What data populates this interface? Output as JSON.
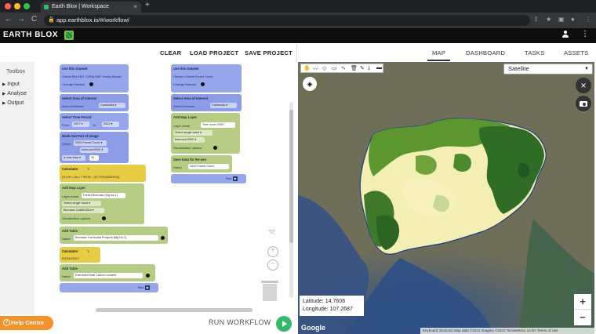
{
  "browser": {
    "tab_title": "Earth Blox | Workspace",
    "url": "app.earthblox.io/#/workflow/",
    "tab_close": "×",
    "new_tab": "+",
    "nav_back": "←",
    "nav_forward": "→",
    "nav_reload": "C",
    "lock": "🔒"
  },
  "app": {
    "logo": "EARTH BLOX",
    "more": "⋮"
  },
  "toolbar": {
    "clear": "CLEAR",
    "load_project": "LOAD PROJECT",
    "save_project": "SAVE PROJECT"
  },
  "toolbox": {
    "title": "Toolbox",
    "items": [
      "Input",
      "Analyse",
      "Output"
    ]
  },
  "workflow_left": {
    "dataset_header": "Use this Dataset",
    "dataset_line1": "Global PALSAR L2/PALSAR Yearly Mosaic",
    "change_dataset": "Change Dataset",
    "aoi_header": "Select Area of Interest",
    "aoi_label": "Area of Interest",
    "aoi_value": "Cambodia ▾",
    "time_header": "Select Time Period",
    "time_from_label": "From",
    "time_from": "2007 ▾",
    "time_to_label": "To",
    "time_to": "2021 ▾",
    "mask_header": "Mask Out Part of Image",
    "mask_where_label": "Where",
    "mask_where": "2000 Forest Cover ▾",
    "mask_band": "treecover2000 ▾",
    "mask_cond": "is less than ▾",
    "mask_value": "30",
    "calc1_header": "Calculator",
    "calc1_formula": "(S1 Bi+ (Ja x 7*6230 -  (6/775*0(2BIOV0))",
    "maplayer_header": "Add Map Layer",
    "maplayer_name_label": "Layer name",
    "maplayer_name": "Forest Biomass (Mg ha-1)",
    "maplayer_band": "Select single band ▾",
    "maplayer_band_value": "Biomass CAMBODIA ▾",
    "vis_options": "Visualization options",
    "table1_header": "Add Table",
    "table1_name_label": "Name",
    "table1_name": "Biomass Cambodia Projects (Mg ha-1)",
    "calc2_header": "Calculator",
    "calc2_formula": "BIOMASS/2",
    "table2_header": "Add Table",
    "table2_name_label": "Name",
    "table2_name": "Estimated total Carbon content",
    "run": "Run"
  },
  "workflow_right": {
    "dataset_header": "Use this Dataset",
    "dataset_line1": "Hansen Global Forest Cover",
    "change_dataset": "Change Dataset",
    "aoi_header": "Select Area of Interest",
    "aoi_label": "Area of Interest",
    "aoi_value": "Cambodia ▾",
    "maplayer_header": "Add Map Layer",
    "maplayer_name_label": "Layer name",
    "maplayer_name": "Tree cover 2000",
    "maplayer_band": "Select single band ▾",
    "maplayer_band_value": "treecover2000 ▾",
    "vis_options": "Visualization options",
    "save_header": "Save Data for Re-use",
    "save_name_label": "Name",
    "save_name": "2000 Forest Cover",
    "run": "Run"
  },
  "bottom": {
    "help": "Help Centre",
    "help_icon": "?",
    "run_workflow": "RUN WORKFLOW"
  },
  "canvas_controls": {
    "zoom_in": "+",
    "zoom_out": "−",
    "fit": "⤧"
  },
  "right_nav": {
    "map": "MAP",
    "dashboard": "DASHBOARD",
    "tasks": "TASKS",
    "assets": "ASSETS"
  },
  "map": {
    "basemap": "Satellite",
    "close": "×",
    "latitude": "Latitude: 14.7606",
    "longitude": "Longitude: 107.2687",
    "google": "Google",
    "attribution": "Keyboard shortcuts  Map data ©2023 Imagery ©2023 TerraMetrics  10 km  Terms of Use",
    "zoom_in": "+",
    "zoom_out": "−"
  },
  "colors": {
    "forest_dark": "#2f6d27",
    "forest_mid": "#5c962f",
    "cropland": "#f3eeb2",
    "block_blue": "#96a6ea",
    "block_green": "#b4cd82",
    "block_yellow": "#e6cd43",
    "run_green": "#35b86b",
    "help_orange": "#f5922a"
  }
}
